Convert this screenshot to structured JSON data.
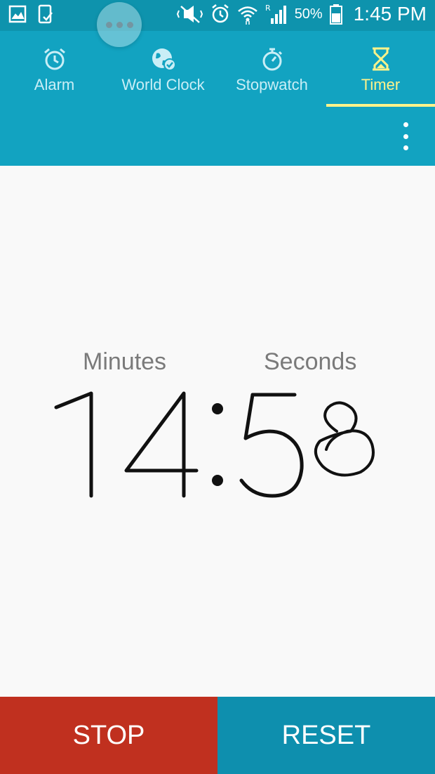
{
  "status_bar": {
    "battery": "50%",
    "time": "1:45 PM",
    "icons": [
      "gallery-icon",
      "device-icon",
      "mute-icon",
      "alarm-status-icon",
      "wifi-icon",
      "signal-roaming-icon",
      "battery-icon"
    ]
  },
  "tabs": [
    {
      "label": "Alarm",
      "icon": "alarm-icon",
      "active": false
    },
    {
      "label": "World Clock",
      "icon": "globe-icon",
      "active": false
    },
    {
      "label": "Stopwatch",
      "icon": "stopwatch-icon",
      "active": false
    },
    {
      "label": "Timer",
      "icon": "hourglass-icon",
      "active": true
    }
  ],
  "timer": {
    "minutes_label": "Minutes",
    "seconds_label": "Seconds",
    "display": "14:58"
  },
  "buttons": {
    "stop_label": "STOP",
    "reset_label": "RESET"
  },
  "colors": {
    "header": "#12a3c1",
    "status_bar": "#0e93ad",
    "active_tab": "#fff38a",
    "stop": "#c0301f",
    "reset": "#0e8fae"
  }
}
